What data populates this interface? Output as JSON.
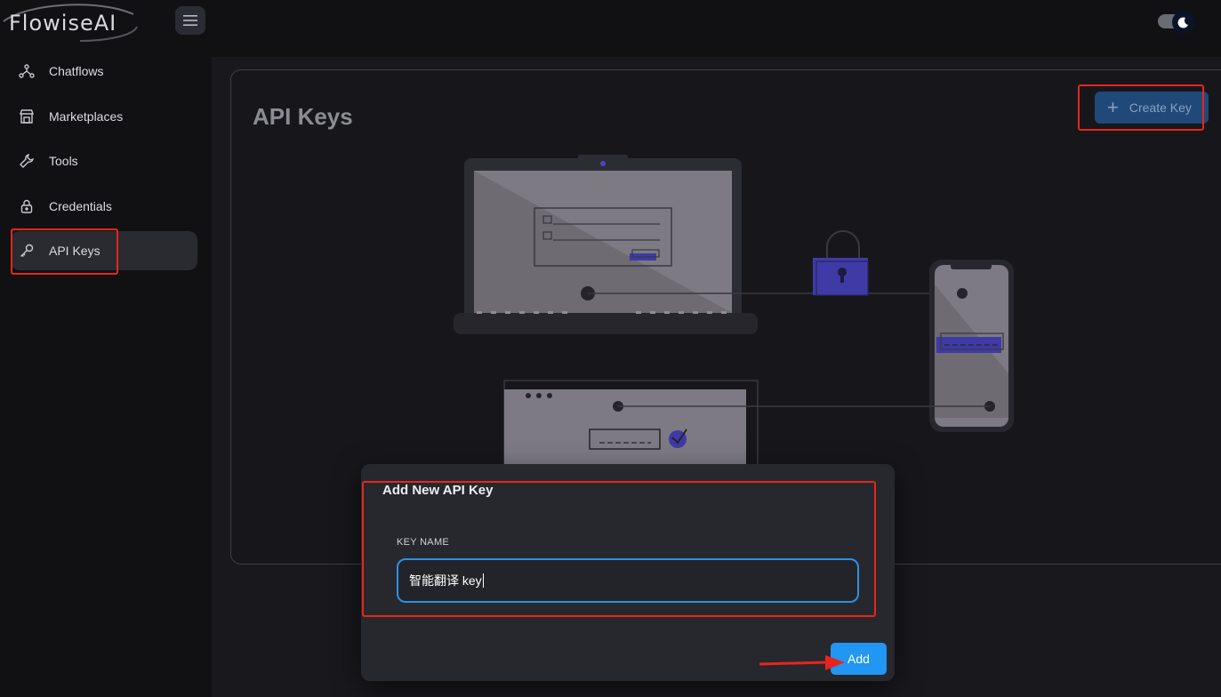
{
  "app": {
    "logo_text": "FlowiseAI"
  },
  "sidebar": {
    "items": [
      {
        "label": "Chatflows",
        "icon": "hierarchy-icon"
      },
      {
        "label": "Marketplaces",
        "icon": "store-icon"
      },
      {
        "label": "Tools",
        "icon": "wrench-icon"
      },
      {
        "label": "Credentials",
        "icon": "lock-icon"
      },
      {
        "label": "API Keys",
        "icon": "key-icon",
        "active": true
      }
    ]
  },
  "main": {
    "title": "API Keys",
    "create_button_label": "Create Key"
  },
  "dialog": {
    "title": "Add New API Key",
    "field_label": "KEY NAME",
    "field_value": "智能翻译 key",
    "add_button_label": "Add"
  },
  "colors": {
    "accent": "#2196f3",
    "annotation": "#e8251c",
    "illustration_purple": "#3f3aa6"
  }
}
